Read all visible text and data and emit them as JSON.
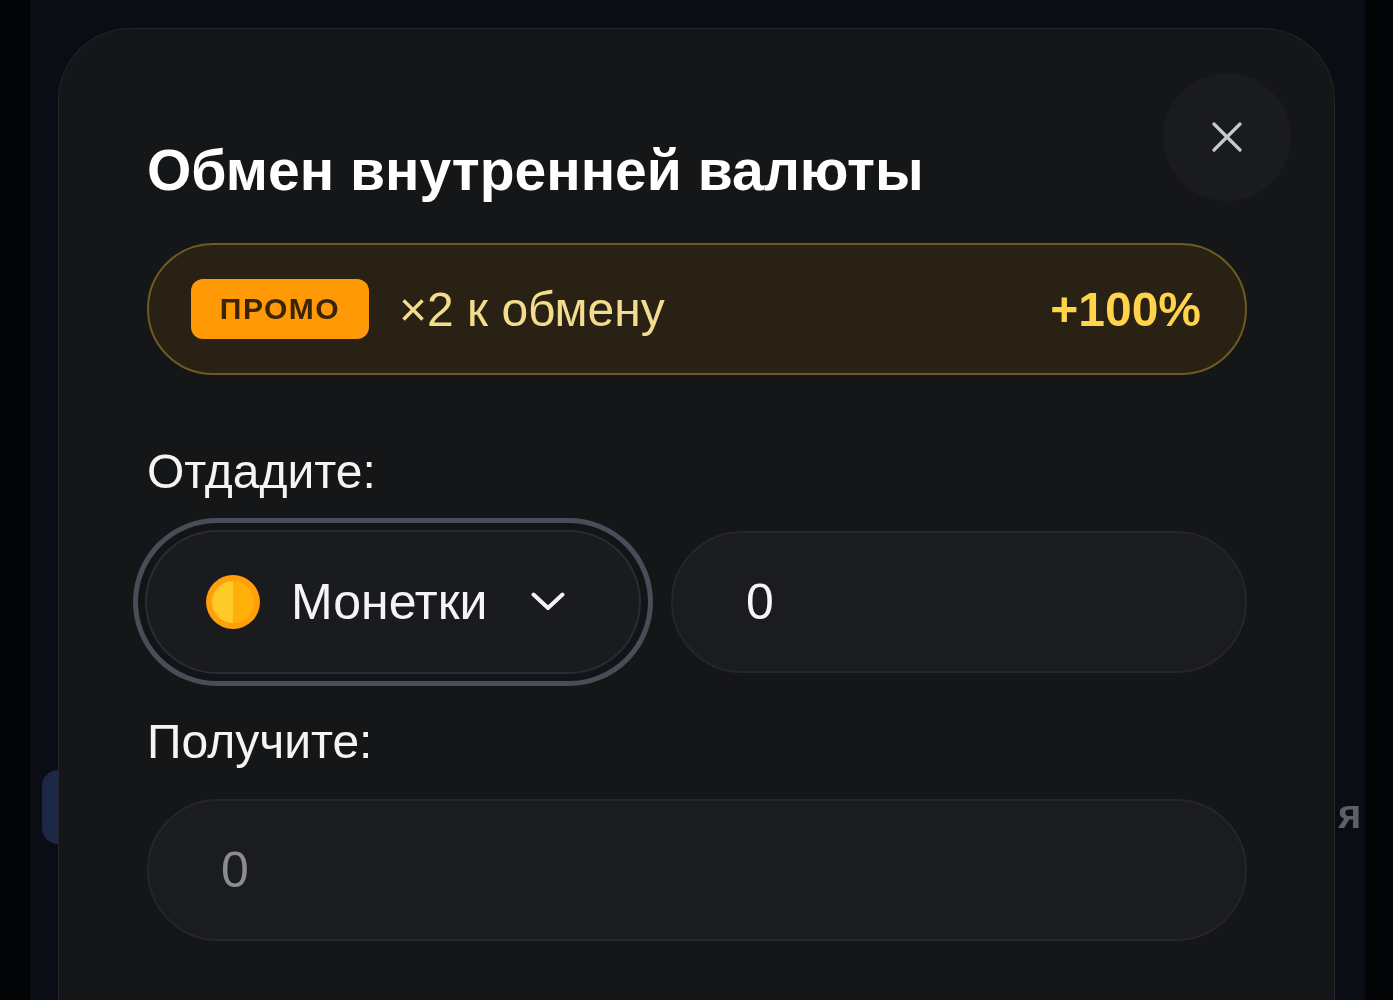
{
  "background": {
    "side_text": "я"
  },
  "dialog": {
    "title": "Обмен внутренней валюты",
    "promo": {
      "badge": "ПРОМО",
      "text": "×2 к обмену",
      "bonus": "+100%"
    },
    "give": {
      "label": "Отдадите:",
      "currency": {
        "name": "Монетки",
        "focused": true
      },
      "amount": "0"
    },
    "receive": {
      "label": "Получите:",
      "amount": "0",
      "disabled": true
    }
  }
}
